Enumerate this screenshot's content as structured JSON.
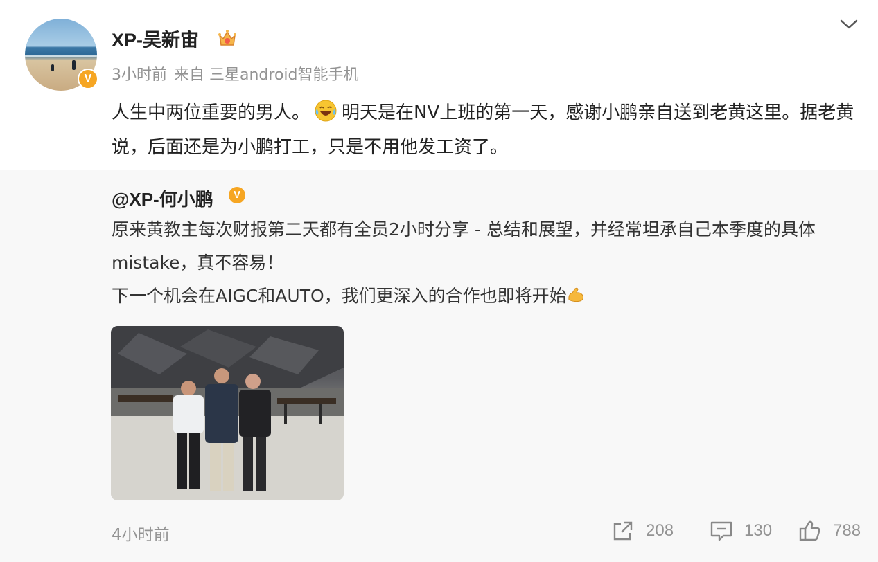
{
  "post": {
    "username": "XP-吴新宙",
    "time": "3小时前",
    "source": "来自 三星android智能手机",
    "text_part1": "人生中两位重要的男人。",
    "text_part2": "明天是在NV上班的第一天，感谢小鹏亲自送到老黄这里。据老黄说，后面还是为小鹏打工，只是不用他发工资了。",
    "verified_mark": "V",
    "emoji_name": "laughing-crying-emoji"
  },
  "repost": {
    "username": "@XP-何小鹏",
    "verified_mark": "V",
    "line1": "原来黄教主每次财报第二天都有全员2小时分享 - 总结和展望，并经常坦承自己本季度的具体mistake，真不容易！",
    "line2": "下一个机会在AIGC和AUTO，我们更深入的合作也即将开始",
    "emoji_name": "flexed-biceps-emoji",
    "time": "4小时前",
    "repost_count": "208",
    "comment_count": "130",
    "like_count": "788"
  },
  "colors": {
    "verified_badge": "#f6a623",
    "muted_text": "#939393",
    "repost_bg": "#f8f8f8"
  }
}
